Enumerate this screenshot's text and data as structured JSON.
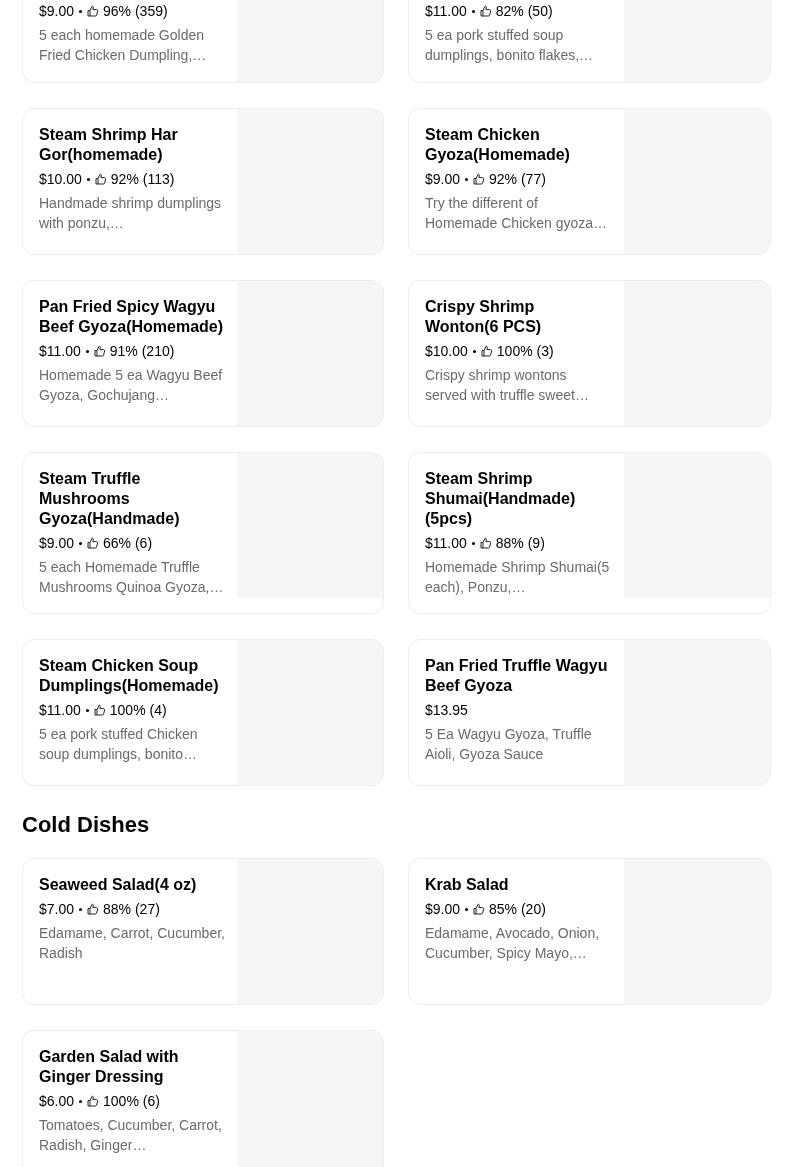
{
  "sections": [
    {
      "items": [
        {
          "price": "$9.00",
          "rating": "96% (359)",
          "description": "5 each homemade Golden Fried Chicken Dumpling,…"
        },
        {
          "price": "$11.00",
          "rating": "82% (50)",
          "description": "5 ea pork stuffed soup dumplings, bonito flakes,…"
        },
        {
          "name": "Steam Shrimp Har Gor(homemade)",
          "price": "$10.00",
          "rating": "92% (113)",
          "description": "Handmade shrimp dumplings with ponzu,…"
        },
        {
          "name": "Steam Chicken Gyoza(Homemade)",
          "price": "$9.00",
          "rating": "92% (77)",
          "description": "Try the different of Homemade Chicken gyoza…"
        },
        {
          "name": "Pan Fried Spicy Wagyu Beef Gyoza(Homemade)",
          "price": "$11.00",
          "rating": "91% (210)",
          "description": "Homemade 5 ea Wagyu Beef Gyoza, Gochujang…"
        },
        {
          "name": "Crispy Shrimp Wonton(6 PCS)",
          "price": "$10.00",
          "rating": "100% (3)",
          "description": "Crispy shrimp wontons served with truffle sweet…"
        },
        {
          "name": "Steam Truffle Mushrooms Gyoza(Handmade)",
          "price": "$9.00",
          "rating": "66% (6)",
          "description": "5 each Homemade Truffle Mushrooms Quinoa Gyoza,…"
        },
        {
          "name": "Steam Shrimp Shumai(Handmade) (5pcs)",
          "price": "$11.00",
          "rating": "88% (9)",
          "description": "Homemade Shrimp Shumai(5 each), Ponzu,…"
        },
        {
          "name": "Steam Chicken Soup Dumplings(Homemade)",
          "price": "$11.00",
          "rating": "100% (4)",
          "description": "5 ea pork stuffed Chicken soup dumplings, bonito…"
        },
        {
          "name": "Pan Fried Truffle Wagyu Beef Gyoza",
          "price": "$13.95",
          "description": "5 Ea Wagyu Gyoza, Truffle Aioli, Gyoza Sauce"
        }
      ]
    },
    {
      "title": "Cold Dishes",
      "items": [
        {
          "name": "Seaweed Salad(4 oz)",
          "price": "$7.00",
          "rating": "88% (27)",
          "description": "Edamame, Carrot, Cucumber, Radish"
        },
        {
          "name": "Krab Salad",
          "price": "$9.00",
          "rating": "85% (20)",
          "description": "Edamame, Avocado, Onion, Cucumber, Spicy Mayo,…"
        },
        {
          "name": "Garden Salad with Ginger Dressing",
          "price": "$6.00",
          "rating": "100% (6)",
          "description": "Tomatoes, Cucumber, Carrot, Radish, Ginger…"
        }
      ]
    }
  ]
}
